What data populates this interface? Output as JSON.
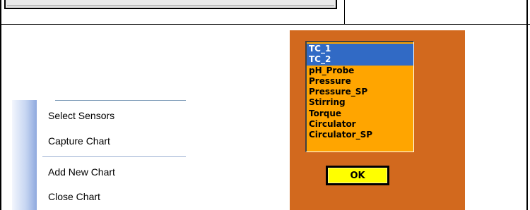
{
  "context_menu": {
    "items": [
      {
        "label": "Select Sensors"
      },
      {
        "label": "Capture Chart"
      },
      {
        "label": "Add New Chart"
      },
      {
        "label": "Close Chart"
      }
    ]
  },
  "sensor_dialog": {
    "sensors": [
      {
        "label": "TC_1",
        "selected": true
      },
      {
        "label": "TC_2",
        "selected": true
      },
      {
        "label": "pH_Probe",
        "selected": false
      },
      {
        "label": "Pressure",
        "selected": false
      },
      {
        "label": "Pressure_SP",
        "selected": false
      },
      {
        "label": "Stirring",
        "selected": false
      },
      {
        "label": "Torque",
        "selected": false
      },
      {
        "label": "Circulator",
        "selected": false
      },
      {
        "label": "Circulator_SP",
        "selected": false
      }
    ],
    "ok_label": "OK"
  },
  "colors": {
    "dialog_bg": "#d2691e",
    "list_bg": "#ffa500",
    "selection": "#316ac5",
    "ok_button": "#ffff00"
  }
}
